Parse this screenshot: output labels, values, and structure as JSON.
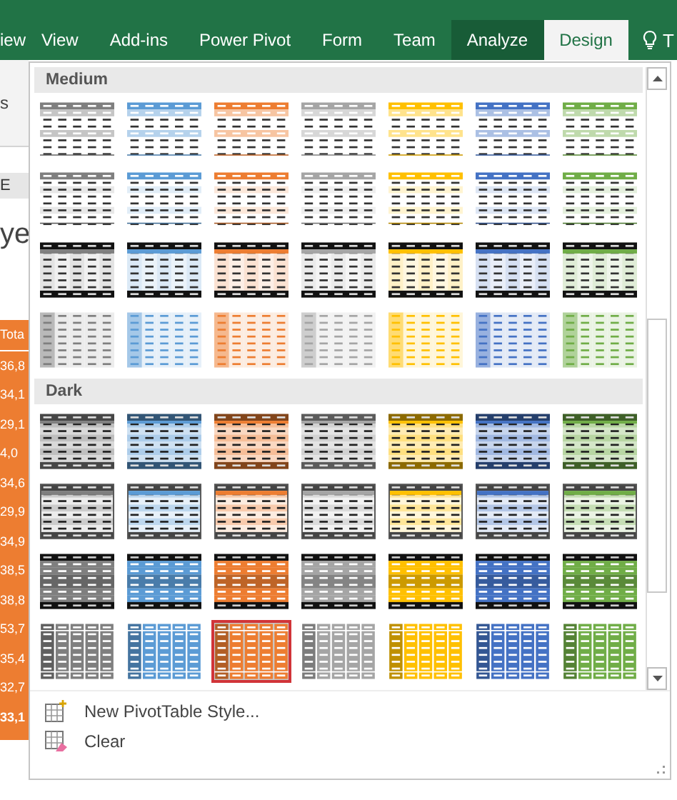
{
  "ribbon": {
    "tabs": [
      {
        "label": "iew",
        "selected": false,
        "contextual": false
      },
      {
        "label": "View",
        "selected": false,
        "contextual": false
      },
      {
        "label": "Add-ins",
        "selected": false,
        "contextual": false
      },
      {
        "label": "Power Pivot",
        "selected": false,
        "contextual": false
      },
      {
        "label": "Form",
        "selected": false,
        "contextual": false
      },
      {
        "label": "Team",
        "selected": false,
        "contextual": false
      },
      {
        "label": "Analyze",
        "selected": false,
        "contextual": true
      },
      {
        "label": "Design",
        "selected": true,
        "contextual": true
      }
    ],
    "tell_me": "T"
  },
  "sheet": {
    "ribbon_text": "s",
    "column_header": "E",
    "heading_text": "ye",
    "cells": [
      "Tota",
      "36,8",
      "34,1",
      "29,1",
      "4,0",
      "34,6",
      "29,9",
      "34,9",
      "38,5",
      "38,8",
      "53,7",
      "35,4",
      "32,7",
      "33,1"
    ]
  },
  "gallery": {
    "sections": [
      {
        "title": "Medium",
        "rows": [
          {
            "kind": "header-bands",
            "styles": [
              {
                "color": "#7f7f7f",
                "selected": false
              },
              {
                "color": "#5b9bd5",
                "selected": false
              },
              {
                "color": "#ed7d31",
                "selected": false
              },
              {
                "color": "#a5a5a5",
                "selected": false
              },
              {
                "color": "#ffc000",
                "selected": false
              },
              {
                "color": "#4472c4",
                "selected": false
              },
              {
                "color": "#70ad47",
                "selected": false
              }
            ]
          },
          {
            "kind": "header-lines",
            "styles": [
              {
                "color": "#7f7f7f",
                "selected": false
              },
              {
                "color": "#5b9bd5",
                "selected": false
              },
              {
                "color": "#ed7d31",
                "selected": false
              },
              {
                "color": "#a5a5a5",
                "selected": false
              },
              {
                "color": "#ffc000",
                "selected": false
              },
              {
                "color": "#4472c4",
                "selected": false
              },
              {
                "color": "#70ad47",
                "selected": false
              }
            ]
          },
          {
            "kind": "black-ends",
            "styles": [
              {
                "color": "#7f7f7f",
                "selected": false
              },
              {
                "color": "#5b9bd5",
                "selected": false
              },
              {
                "color": "#ed7d31",
                "selected": false
              },
              {
                "color": "#a5a5a5",
                "selected": false
              },
              {
                "color": "#ffc000",
                "selected": false
              },
              {
                "color": "#4472c4",
                "selected": false
              },
              {
                "color": "#70ad47",
                "selected": false
              }
            ]
          },
          {
            "kind": "column-tint",
            "styles": [
              {
                "color": "#7f7f7f",
                "selected": false
              },
              {
                "color": "#5b9bd5",
                "selected": false
              },
              {
                "color": "#ed7d31",
                "selected": false
              },
              {
                "color": "#a5a5a5",
                "selected": false
              },
              {
                "color": "#ffc000",
                "selected": false
              },
              {
                "color": "#4472c4",
                "selected": false
              },
              {
                "color": "#70ad47",
                "selected": false
              }
            ]
          }
        ]
      },
      {
        "title": "Dark",
        "rows": [
          {
            "kind": "dark-ends",
            "styles": [
              {
                "color": "#7f7f7f",
                "selected": false
              },
              {
                "color": "#5b9bd5",
                "selected": false
              },
              {
                "color": "#ed7d31",
                "selected": false
              },
              {
                "color": "#a5a5a5",
                "selected": false
              },
              {
                "color": "#ffc000",
                "selected": false
              },
              {
                "color": "#4472c4",
                "selected": false
              },
              {
                "color": "#70ad47",
                "selected": false
              }
            ]
          },
          {
            "kind": "dark-frame",
            "styles": [
              {
                "color": "#7f7f7f",
                "selected": false
              },
              {
                "color": "#5b9bd5",
                "selected": false
              },
              {
                "color": "#ed7d31",
                "selected": false
              },
              {
                "color": "#a5a5a5",
                "selected": false
              },
              {
                "color": "#ffc000",
                "selected": false
              },
              {
                "color": "#4472c4",
                "selected": false
              },
              {
                "color": "#70ad47",
                "selected": false
              }
            ]
          },
          {
            "kind": "black-solid",
            "styles": [
              {
                "color": "#7f7f7f",
                "selected": false
              },
              {
                "color": "#5b9bd5",
                "selected": false
              },
              {
                "color": "#ed7d31",
                "selected": false
              },
              {
                "color": "#a5a5a5",
                "selected": false
              },
              {
                "color": "#ffc000",
                "selected": false
              },
              {
                "color": "#4472c4",
                "selected": false
              },
              {
                "color": "#70ad47",
                "selected": false
              }
            ]
          },
          {
            "kind": "solid-columns",
            "styles": [
              {
                "color": "#7f7f7f",
                "selected": false
              },
              {
                "color": "#5b9bd5",
                "selected": false
              },
              {
                "color": "#ed7d31",
                "selected": true
              },
              {
                "color": "#a5a5a5",
                "selected": false
              },
              {
                "color": "#ffc000",
                "selected": false
              },
              {
                "color": "#4472c4",
                "selected": false
              },
              {
                "color": "#70ad47",
                "selected": false
              }
            ]
          }
        ]
      }
    ]
  },
  "menu": [
    {
      "kind": "new-style",
      "label": "New PivotTable Style..."
    },
    {
      "kind": "clear",
      "label": "Clear"
    }
  ]
}
